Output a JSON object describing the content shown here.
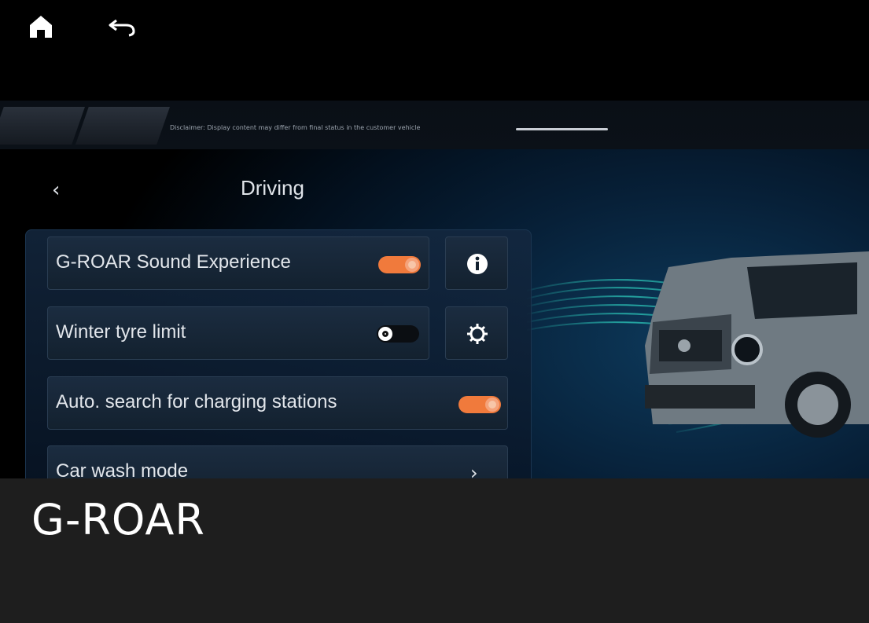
{
  "nav": {
    "home_icon": "home-icon",
    "back_icon": "return-arrow-icon",
    "disclaimer": "Disclaimer: Display content may differ from final status in the customer vehicle"
  },
  "page": {
    "title": "Driving",
    "back_icon": "chevron-left-icon"
  },
  "settings": [
    {
      "label": "G-ROAR Sound Experience",
      "control": "toggle",
      "state": "on",
      "side_icon": "info-icon"
    },
    {
      "label": "Winter tyre limit",
      "control": "toggle",
      "state": "off",
      "side_icon": "gear-icon"
    },
    {
      "label": "Auto. search for charging stations",
      "control": "toggle",
      "state": "on"
    },
    {
      "label": "Car wash mode",
      "control": "chevron",
      "icon": "chevron-right-icon"
    }
  ],
  "caption": {
    "text": "G-ROAR"
  },
  "colors": {
    "toggle_on": "#f07a3c",
    "accent_streak": "#2fd6c4",
    "caption_bg": "#1e1e1e"
  }
}
